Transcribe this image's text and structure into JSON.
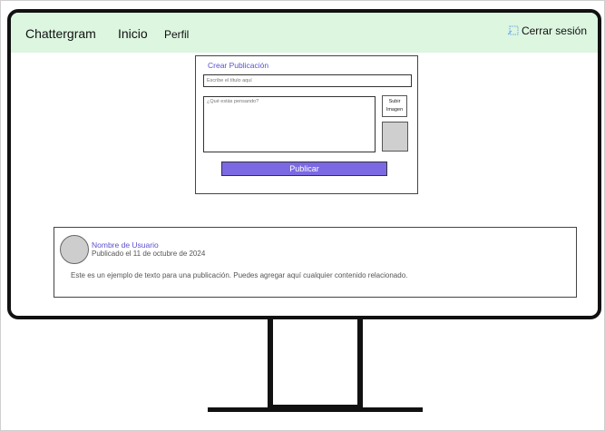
{
  "nav": {
    "brand": "Chattergram",
    "inicio": "Inicio",
    "perfil": "Perfil",
    "logout": "Cerrar sesión",
    "logout_icon": "logout-icon"
  },
  "create_post": {
    "title": "Crear Publicación",
    "title_placeholder": "Escribe el título aquí",
    "body_placeholder": "¿Qué estás pensando?",
    "upload_label_line1": "Subir",
    "upload_label_line2": "Imagen",
    "publish_label": "Publicar"
  },
  "post": {
    "author": "Nombre de Usuario",
    "date": "Publicado el 11 de octubre de 2024",
    "text": "Este es un ejemplo de texto para una publicación. Puedes agregar aquí cualquier contenido relacionado."
  },
  "colors": {
    "navbar_bg": "#dcf6e0",
    "accent": "#7b69e3",
    "link_text": "#5a4fcf"
  }
}
